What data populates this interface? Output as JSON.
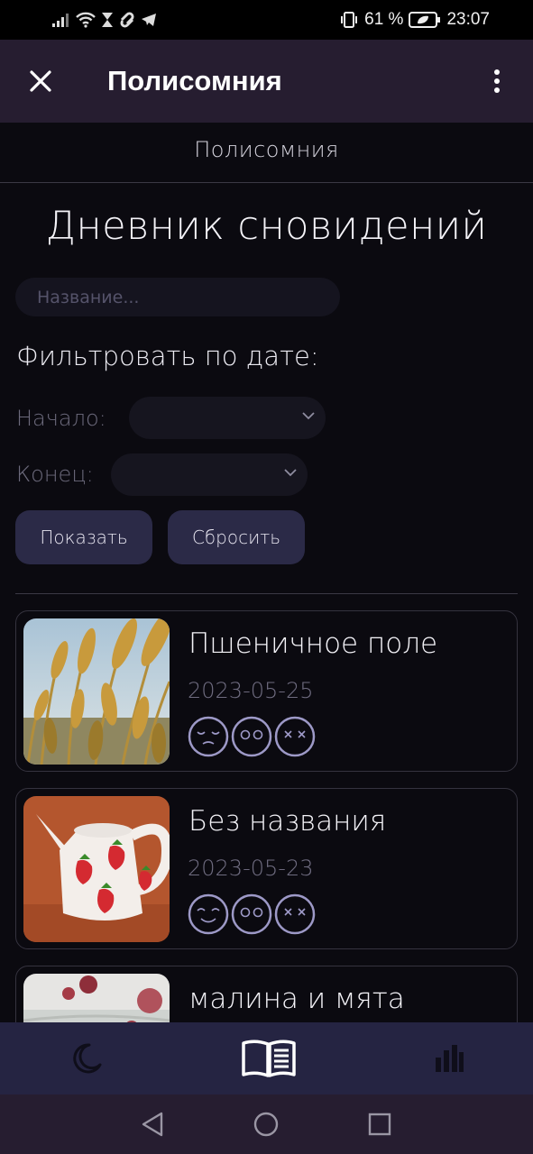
{
  "status_bar": {
    "battery_percent": "61 %",
    "time": "23:07",
    "icons": [
      "signal-icon",
      "wifi-icon",
      "hourglass-icon",
      "link-icon",
      "telegram-icon",
      "vibrate-icon",
      "battery-saver-icon"
    ]
  },
  "app_bar": {
    "title": "Полисомния",
    "close_icon": "close-icon",
    "menu_icon": "more-vert-icon"
  },
  "page": {
    "site_title": "Полисомния",
    "heading": "Дневник сновидений",
    "search_placeholder": "Название...",
    "filter_label": "Фильтровать по дате:",
    "start_label": "Начало:",
    "end_label": "Конец:",
    "show_button": "Показать",
    "reset_button": "Сбросить"
  },
  "entries": [
    {
      "title": "Пшеничное поле",
      "date": "2023-05-25",
      "faces": [
        "sleepy-face-icon",
        "eyes-open-face-icon",
        "x-eyes-face-icon"
      ]
    },
    {
      "title": "Без названия",
      "date": "2023-05-23",
      "faces": [
        "smile-face-icon",
        "eyes-open-face-icon",
        "x-eyes-face-icon"
      ]
    },
    {
      "title": "малина и мята"
    }
  ],
  "bottom_nav": {
    "items": [
      "moon-icon",
      "open-book-icon",
      "bar-chart-icon"
    ],
    "active": "open-book-icon"
  },
  "system_nav": [
    "back-icon",
    "home-icon",
    "recents-icon"
  ],
  "colors": {
    "app_bar": "#261d30",
    "background": "#0b0a10",
    "button": "#2b2a47",
    "bottom_nav": "#252442",
    "face_stroke": "#9d99c7"
  }
}
